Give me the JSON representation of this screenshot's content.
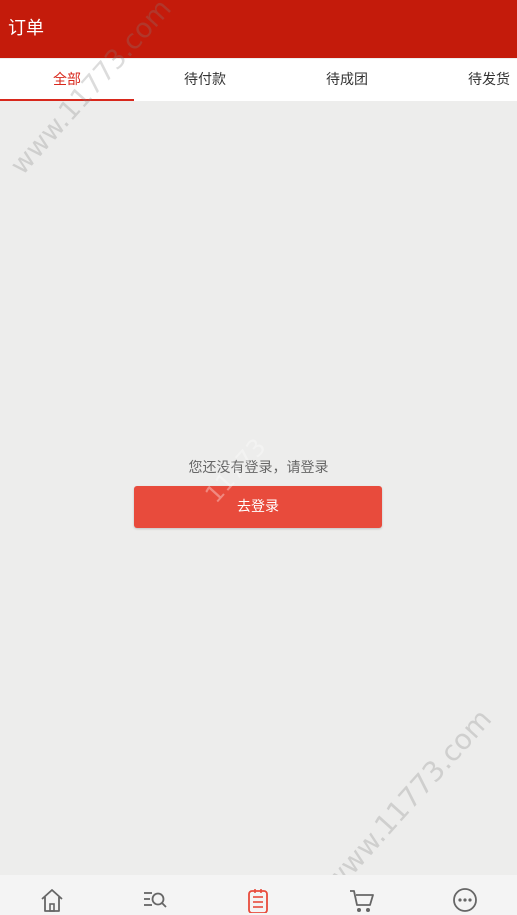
{
  "header": {
    "title": "订单"
  },
  "tabs": [
    {
      "label": "全部",
      "active": true
    },
    {
      "label": "待付款",
      "active": false
    },
    {
      "label": "待成团",
      "active": false
    },
    {
      "label": "待发货",
      "active": false
    }
  ],
  "empty_state": {
    "message": "您还没有登录，请登录",
    "button_label": "去登录"
  },
  "watermark": {
    "text": "www.11773.com"
  },
  "bottom_nav": [
    {
      "icon": "home-icon",
      "active": false
    },
    {
      "icon": "category-search-icon",
      "active": false
    },
    {
      "icon": "order-list-icon",
      "active": true
    },
    {
      "icon": "cart-icon",
      "active": false
    },
    {
      "icon": "more-icon",
      "active": false
    }
  ],
  "colors": {
    "header_bg": "#c41b0b",
    "accent": "#d8281c",
    "button_bg": "#e84b3c",
    "page_bg": "#ededec"
  }
}
